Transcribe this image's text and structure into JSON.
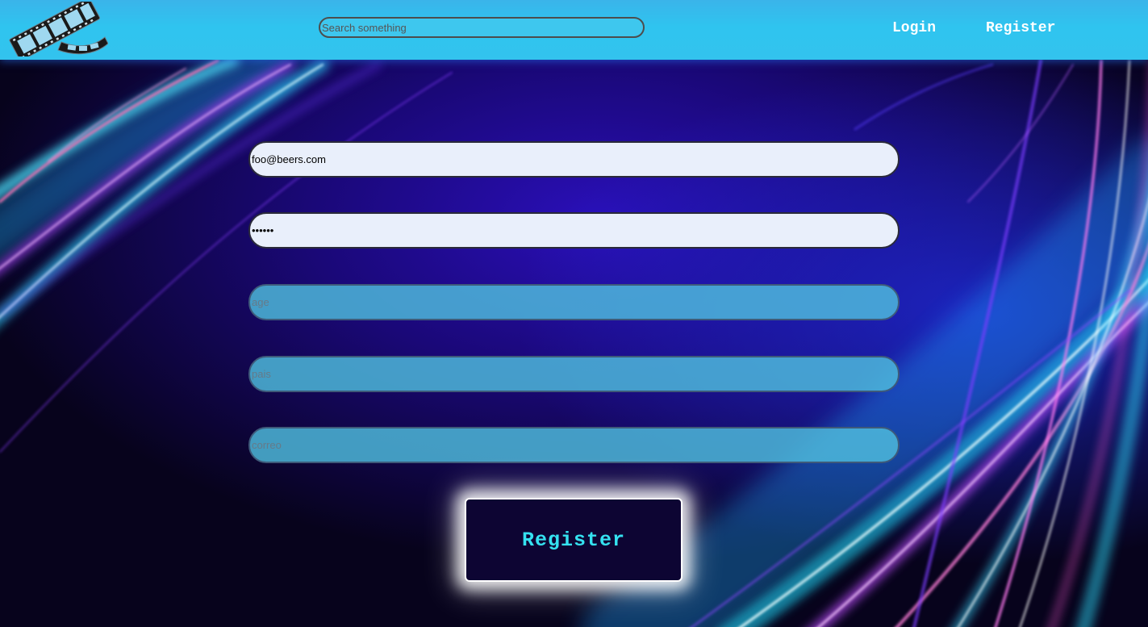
{
  "header": {
    "search_placeholder": "Search something",
    "nav": {
      "login": "Login",
      "register": "Register"
    }
  },
  "form": {
    "email_value": "foo@beers.com",
    "password_value": "••••••",
    "age_placeholder": "age",
    "pais_placeholder": "pais",
    "correo_placeholder": "correo",
    "submit_label": "Register"
  },
  "colors": {
    "header_bg": "#33c3ee",
    "submit_bg": "#0d0533",
    "submit_text": "#35e2f0",
    "field_filled_bg": "#e9effb"
  },
  "icons": {
    "logo": "film-reel-icon"
  }
}
